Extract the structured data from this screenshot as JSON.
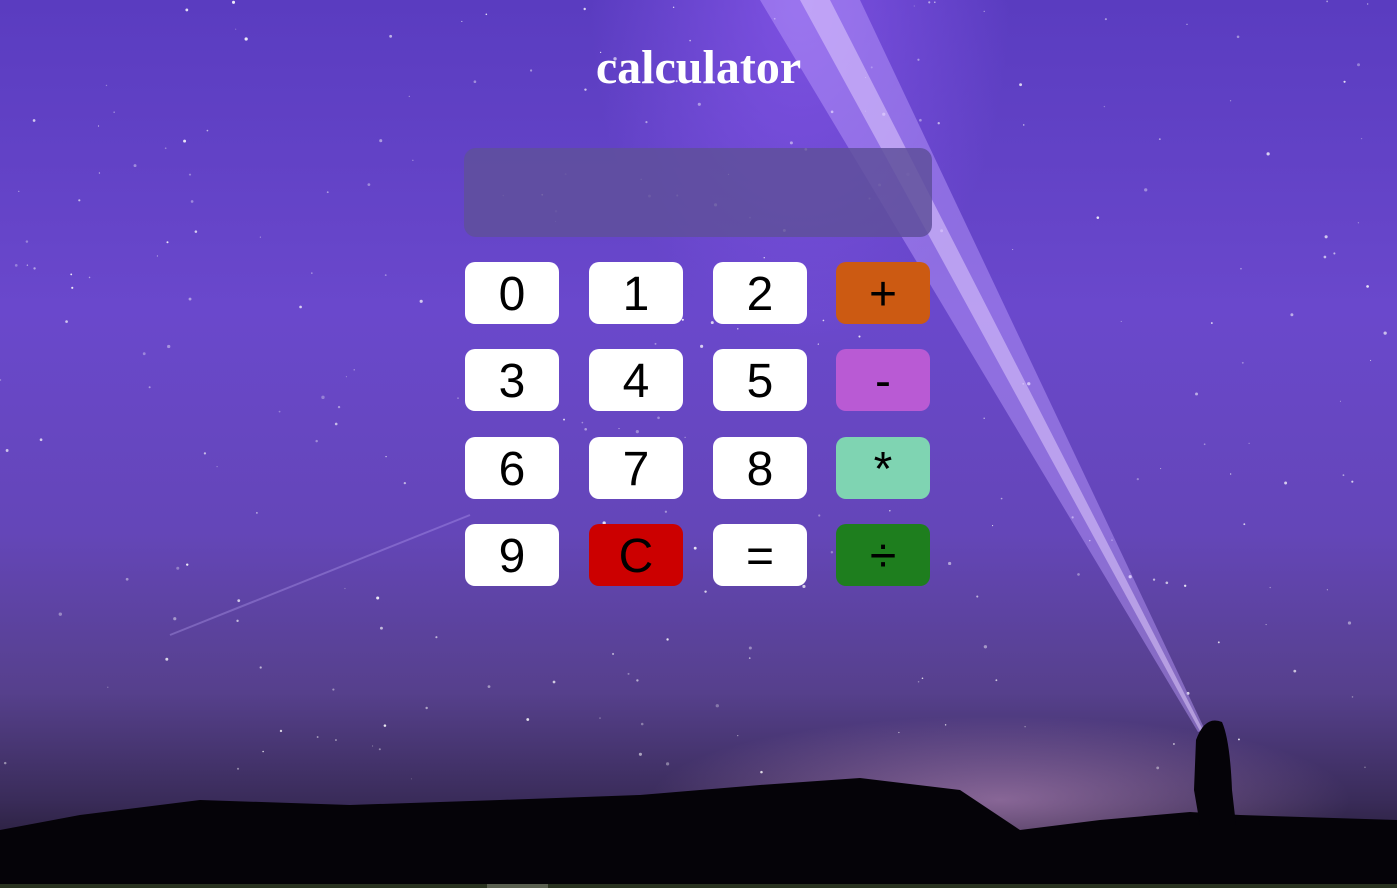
{
  "title": "calculator",
  "display": {
    "value": ""
  },
  "buttons": [
    {
      "label": "0",
      "color": "#ffffff"
    },
    {
      "label": "1",
      "color": "#ffffff"
    },
    {
      "label": "2",
      "color": "#ffffff"
    },
    {
      "label": "+",
      "color": "#cc5a12"
    },
    {
      "label": "3",
      "color": "#ffffff"
    },
    {
      "label": "4",
      "color": "#ffffff"
    },
    {
      "label": "5",
      "color": "#ffffff"
    },
    {
      "label": "-",
      "color": "#b95ad4"
    },
    {
      "label": "6",
      "color": "#ffffff"
    },
    {
      "label": "7",
      "color": "#ffffff"
    },
    {
      "label": "8",
      "color": "#ffffff"
    },
    {
      "label": "*",
      "color": "#7fd4b2"
    },
    {
      "label": "9",
      "color": "#ffffff"
    },
    {
      "label": "C",
      "color": "#cc0000"
    },
    {
      "label": "=",
      "color": "#ffffff"
    },
    {
      "label": "÷",
      "color": "#1e7e1e"
    }
  ]
}
